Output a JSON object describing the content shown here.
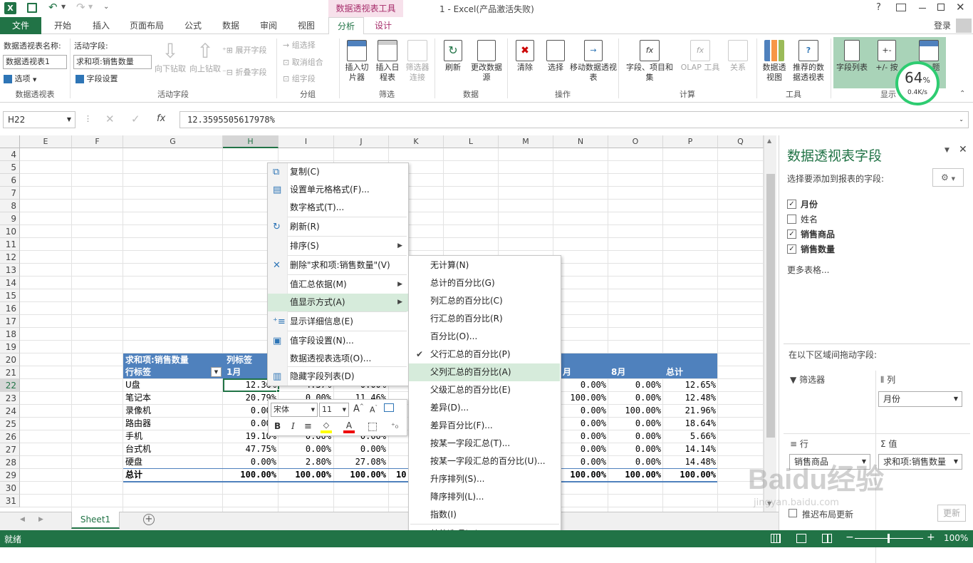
{
  "window": {
    "title": "1 - Excel(产品激活失败)",
    "context_tool": "数据透视表工具",
    "help": "?",
    "login": "登录"
  },
  "tabs": [
    "文件",
    "开始",
    "插入",
    "页面布局",
    "公式",
    "数据",
    "审阅",
    "视图",
    "分析",
    "设计"
  ],
  "ribbon": {
    "pivot_name_label": "数据透视表名称:",
    "pivot_name_value": "数据透视表1",
    "options_label": "选项",
    "active_field_label": "活动字段:",
    "active_field_value": "求和项:销售数量",
    "field_settings": "字段设置",
    "drill_down": "向下钻取",
    "drill_up": "向上钻取",
    "expand_field": "展开字段",
    "collapse_field": "折叠字段",
    "group_selection": "组选择",
    "ungroup": "取消组合",
    "group_field": "组字段",
    "insert_slicer": "插入切片器",
    "insert_timeline": "插入日程表",
    "filter_connections": "筛选器连接",
    "refresh": "刷新",
    "change_source": "更改数据源",
    "clear": "清除",
    "select": "选择",
    "move_pivot": "移动数据透视表",
    "fields_items_sets": "字段、项目和集",
    "olap_tools": "OLAP 工具",
    "relationships": "关系",
    "pivot_chart": "数据透视图",
    "recommended_pivot": "推荐的数据透视表",
    "field_list": "字段列表",
    "buttons": "+/- 按",
    "headers": "题",
    "groups": {
      "pivot": "数据透视表",
      "active_field": "活动字段",
      "group": "分组",
      "filter": "筛选",
      "data": "数据",
      "actions": "操作",
      "calc": "计算",
      "tools": "工具",
      "show": "显示"
    },
    "speed_percent": "64",
    "speed_unit": "%",
    "speed_rate": "0.4K/s"
  },
  "formula": {
    "name_box": "H22",
    "fx": "fx",
    "value": "12.3595505617978%"
  },
  "columns": [
    "E",
    "F",
    "G",
    "H",
    "I",
    "J",
    "K",
    "L",
    "M",
    "N",
    "O",
    "P",
    "Q"
  ],
  "rows": [
    "4",
    "5",
    "6",
    "7",
    "8",
    "9",
    "10",
    "11",
    "12",
    "13",
    "14",
    "15",
    "16",
    "17",
    "18",
    "19",
    "20",
    "21",
    "22",
    "23",
    "24",
    "25",
    "26",
    "27",
    "28",
    "29",
    "30",
    "31"
  ],
  "pivot": {
    "header1": "求和项:销售数量",
    "header2": "列标签",
    "row_label": "行标签",
    "col_1": "1月",
    "col_n": "月",
    "col_8": "8月",
    "col_total": "总计",
    "rows": [
      {
        "name": "U盘",
        "h": "12.36%",
        "i": "4.37%",
        "j": "0.00%",
        "n": "0.00%",
        "o": "0.00%",
        "p": "12.65%"
      },
      {
        "name": "笔记本",
        "h": "20.79%",
        "i": "0.00%",
        "j": "11.46%",
        "n": "100.00%",
        "o": "0.00%",
        "p": "12.48%"
      },
      {
        "name": "录像机",
        "h": "0.00%",
        "i": "",
        "j": "",
        "n": "0.00%",
        "o": "100.00%",
        "p": "21.96%"
      },
      {
        "name": "路由器",
        "h": "0.00%",
        "i": "",
        "j": "",
        "n": "0.00%",
        "o": "0.00%",
        "p": "18.64%"
      },
      {
        "name": "手机",
        "h": "19.10%",
        "i": "0.00%",
        "j": "0.00%",
        "n": "0.00%",
        "o": "0.00%",
        "p": "5.66%"
      },
      {
        "name": "台式机",
        "h": "47.75%",
        "i": "0.00%",
        "j": "0.00%",
        "n": "0.00%",
        "o": "0.00%",
        "p": "14.14%"
      },
      {
        "name": "硬盘",
        "h": "0.00%",
        "i": "2.80%",
        "j": "27.08%",
        "n": "0.00%",
        "o": "0.00%",
        "p": "14.48%"
      }
    ],
    "total": {
      "name": "总计",
      "h": "100.00%",
      "i": "100.00%",
      "j": "100.00%",
      "k": "10",
      "n": "100.00%",
      "o": "100.00%",
      "p": "100.00%"
    }
  },
  "context_menu": [
    {
      "label": "复制(C)",
      "icon": "copy-icon"
    },
    {
      "label": "设置单元格格式(F)...",
      "icon": "format-cells-icon"
    },
    {
      "label": "数字格式(T)..."
    },
    {
      "label": "刷新(R)",
      "icon": "refresh-icon"
    },
    {
      "label": "排序(S)",
      "submenu": true
    },
    {
      "label": "删除\"求和项:销售数量\"(V)",
      "icon": "delete-x-icon"
    },
    {
      "label": "值汇总依据(M)",
      "submenu": true
    },
    {
      "label": "值显示方式(A)",
      "submenu": true
    },
    {
      "label": "显示详细信息(E)",
      "icon": "show-details-icon"
    },
    {
      "label": "值字段设置(N)...",
      "icon": "value-field-settings-icon"
    },
    {
      "label": "数据透视表选项(O)..."
    },
    {
      "label": "隐藏字段列表(D)",
      "icon": "field-list-icon"
    }
  ],
  "submenu": [
    "无计算(N)",
    "总计的百分比(G)",
    "列汇总的百分比(C)",
    "行汇总的百分比(R)",
    "百分比(O)...",
    "父行汇总的百分比(P)",
    "父列汇总的百分比(A)",
    "父级汇总的百分比(E)",
    "差异(D)...",
    "差异百分比(F)...",
    "按某一字段汇总(T)...",
    "按某一字段汇总的百分比(U)...",
    "升序排列(S)...",
    "降序排列(L)...",
    "指数(I)",
    "其他选项(M)..."
  ],
  "mini_toolbar": {
    "font": "宋体",
    "size": "11",
    "bold": "B",
    "italic": "I"
  },
  "field_pane": {
    "title": "数据透视表字段",
    "subtitle": "选择要添加到报表的字段:",
    "fields": [
      {
        "label": "月份",
        "checked": true
      },
      {
        "label": "姓名",
        "checked": false
      },
      {
        "label": "销售商品",
        "checked": true
      },
      {
        "label": "销售数量",
        "checked": true
      }
    ],
    "more_tables": "更多表格...",
    "drag_hint": "在以下区域间拖动字段:",
    "filters": "筛选器",
    "columns": "列",
    "columns_value": "月份",
    "rows": "行",
    "rows_value": "销售商品",
    "values": "值",
    "values_value": "求和项:销售数量",
    "defer": "推迟布局更新",
    "update": "更新"
  },
  "sheet_tab": "Sheet1",
  "status": {
    "ready": "就绪",
    "zoom": "100%"
  },
  "watermark": {
    "logo": "Baidu经验",
    "url": "jingyan.baidu.com"
  },
  "colors": {
    "excel_green": "#217346",
    "pivot_blue": "#4f81bd",
    "highlight": "#d6ebdb",
    "accent": "#2e75b6"
  }
}
